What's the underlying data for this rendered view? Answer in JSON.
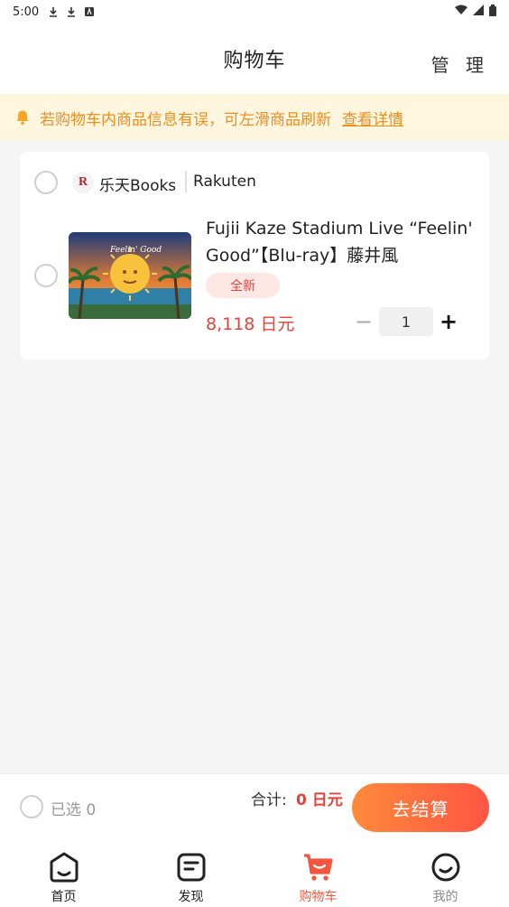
{
  "status_bar": {
    "time": "5:00"
  },
  "header": {
    "title": "购物车",
    "manage_label": "管 理"
  },
  "notice": {
    "text": "若购物车内商品信息有误，可左滑商品刷新",
    "link_label": "查看详情"
  },
  "shop": {
    "logo_letter": "R",
    "name": "乐天Books",
    "brand": "Rakuten"
  },
  "product": {
    "title": "Fujii Kaze Stadium Live “Feelin' Good”【Blu-ray】藤井風",
    "cover_text": "Feelin' Good",
    "tag": "全新",
    "price": "8,118 日元",
    "quantity": "1",
    "minus_label": "−",
    "plus_label": "+"
  },
  "checkout": {
    "selected_label": "已选 0",
    "total_label": "合计:",
    "total_value": "0 日元",
    "button_label": "去结算"
  },
  "tabbar": {
    "items": [
      {
        "label": "首页",
        "icon": "home-icon"
      },
      {
        "label": "发现",
        "icon": "discover-icon"
      },
      {
        "label": "购物车",
        "icon": "cart-icon",
        "active": true
      },
      {
        "label": "我的",
        "icon": "profile-icon"
      }
    ]
  },
  "colors": {
    "accent": "#f4553e",
    "price": "#e2443a",
    "notice_text": "#f28c1c",
    "notice_bg": "#fff6e0"
  }
}
